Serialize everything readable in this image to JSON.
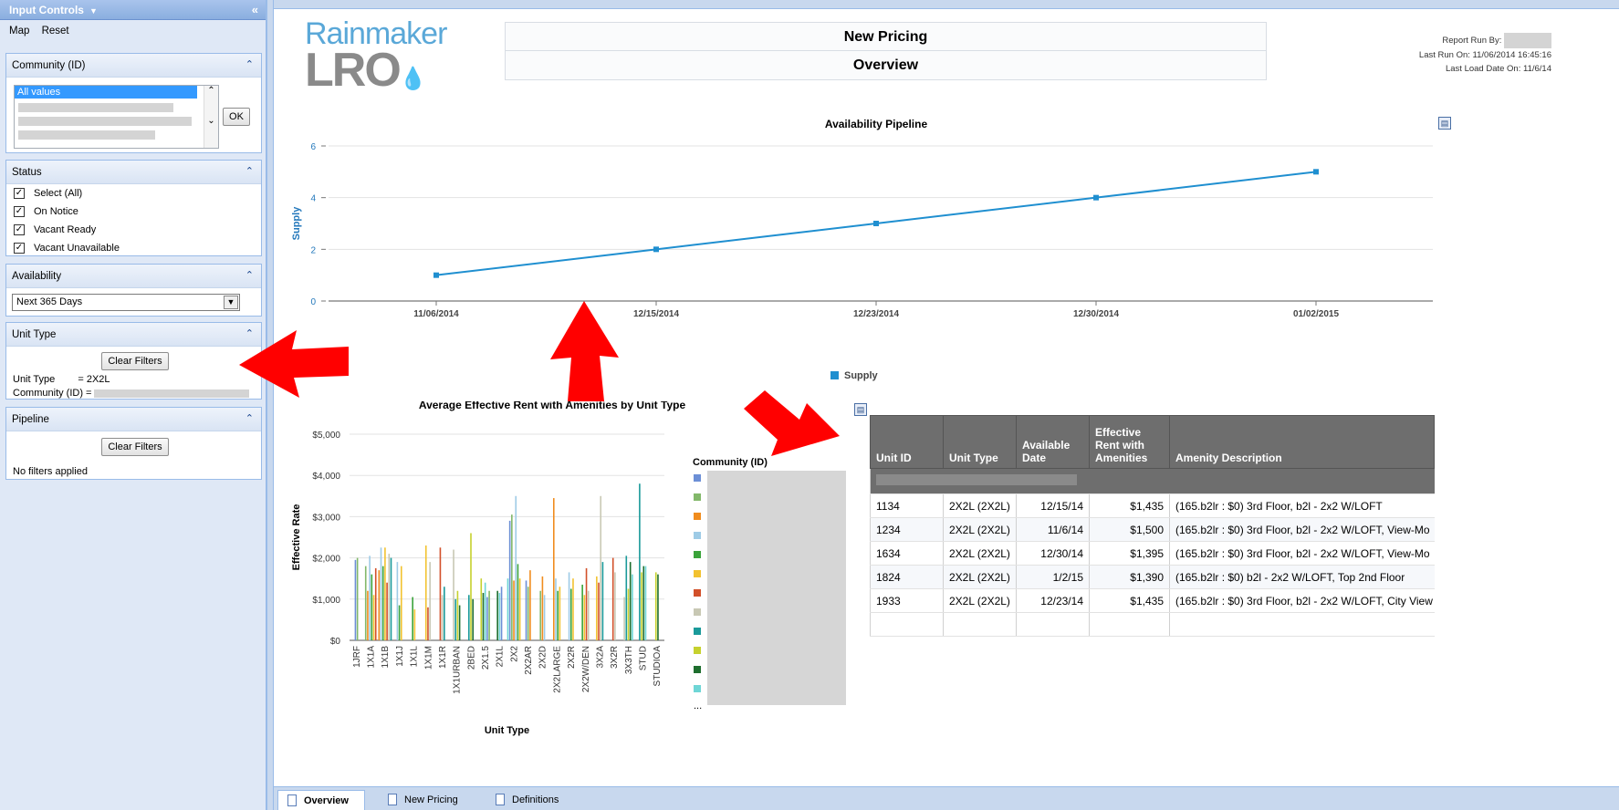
{
  "input_controls": {
    "title": "Input Controls",
    "toolbar": {
      "map": "Map",
      "reset": "Reset"
    },
    "community": {
      "header": "Community (ID)",
      "selected_value": "All values",
      "ok_label": "OK"
    },
    "status": {
      "header": "Status",
      "options": [
        "Select (All)",
        "On Notice",
        "Vacant Ready",
        "Vacant Unavailable"
      ]
    },
    "availability": {
      "header": "Availability",
      "selected": "Next 365 Days"
    },
    "unit_type": {
      "header": "Unit Type",
      "clear_label": "Clear Filters",
      "filter_unit_label": "Unit Type",
      "filter_unit_value": "= 2X2L",
      "filter_community_label": "Community (ID) ="
    },
    "pipeline": {
      "header": "Pipeline",
      "clear_label": "Clear Filters",
      "empty_text": "No filters applied"
    }
  },
  "report": {
    "logo": {
      "brand": "Rainmaker",
      "product": "LRO"
    },
    "title_line1": "New Pricing",
    "title_line2": "Overview",
    "report_run_by_label": "Report Run By:",
    "last_run_on": "Last Run On: 11/06/2014 16:45:16",
    "last_load_date": "Last Load Date On: 11/6/14"
  },
  "tabs": [
    {
      "label": "Overview",
      "active": true
    },
    {
      "label": "New Pricing",
      "active": false
    },
    {
      "label": "Definitions",
      "active": false
    }
  ],
  "table": {
    "headers": [
      "Unit ID",
      "Unit Type",
      "Available Date",
      "Effective Rent with Amenities",
      "Amenity Description"
    ],
    "rows": [
      [
        "1134",
        "2X2L (2X2L)",
        "12/15/14",
        "$1,435",
        "(165.b2lr : $0)   3rd Floor, b2l - 2x2 W/LOFT"
      ],
      [
        "1234",
        "2X2L (2X2L)",
        "11/6/14",
        "$1,500",
        "(165.b2lr : $0)   3rd Floor, b2l - 2x2 W/LOFT, View-Mo"
      ],
      [
        "1634",
        "2X2L (2X2L)",
        "12/30/14",
        "$1,395",
        "(165.b2lr : $0)   3rd Floor, b2l - 2x2 W/LOFT, View-Mo"
      ],
      [
        "1824",
        "2X2L (2X2L)",
        "1/2/15",
        "$1,390",
        "(165.b2lr : $0)   b2l - 2x2 W/LOFT, Top 2nd Floor"
      ],
      [
        "1933",
        "2X2L (2X2L)",
        "12/23/14",
        "$1,435",
        "(165.b2lr : $0)   3rd Floor, b2l - 2x2 W/LOFT, City View"
      ]
    ]
  },
  "chart_data": [
    {
      "type": "line",
      "title": "Availability Pipeline",
      "xlabel": "",
      "ylabel": "Supply",
      "x": [
        "11/06/2014",
        "12/15/2014",
        "12/23/2014",
        "12/30/2014",
        "01/02/2015"
      ],
      "series": [
        {
          "name": "Supply",
          "values": [
            1,
            2,
            3,
            4,
            5
          ],
          "color": "#1f8fd0"
        }
      ],
      "yticks": [
        0,
        2,
        4,
        6
      ],
      "ylim": [
        0,
        6
      ],
      "legend": "bottom"
    },
    {
      "type": "bar",
      "title": "Average Effective Rent with Amenities by Unit Type",
      "xlabel": "Unit Type",
      "ylabel": "Effective Rate",
      "legend_title": "Community (ID)",
      "legend_more": "...",
      "ylim": [
        0,
        5000
      ],
      "yticks": [
        "$0",
        "$1,000",
        "$2,000",
        "$3,000",
        "$4,000",
        "$5,000"
      ],
      "categories": [
        "1JRF",
        "1X1A",
        "1X1B",
        "1X1J",
        "1X1L",
        "1X1M",
        "1X1R",
        "1X1URBAN",
        "2BED",
        "2X1.5",
        "2X1L",
        "2X2",
        "2X2AR",
        "2X2D",
        "2X2LARGE",
        "2X2R",
        "2X2W/DEN",
        "3X2A",
        "3X2R",
        "3X3TH",
        "STUD",
        "STUDIOA"
      ],
      "palette": [
        "#6c8fd6",
        "#82b86a",
        "#f08c1e",
        "#9ecbe6",
        "#3aa33a",
        "#f2c230",
        "#d2502a",
        "#c8c8b4",
        "#1a9a9a",
        "#c6d12e",
        "#1e6e2e",
        "#6fd6d6"
      ],
      "groups": [
        [
          1950,
          2000
        ],
        [
          1800,
          1200,
          2050,
          1600,
          1100,
          1750
        ],
        [
          1700,
          2250,
          1800,
          2250,
          1400,
          2100,
          2000
        ],
        [
          1900,
          850,
          1800
        ],
        [
          1050,
          750
        ],
        [
          2300,
          800,
          1900
        ],
        [
          2250,
          1100,
          1300
        ],
        [
          2200,
          1000,
          1200,
          850
        ],
        [
          1100,
          2600,
          1000
        ],
        [
          1500,
          1150,
          1400,
          1050,
          1200
        ],
        [
          1200,
          1150,
          1300
        ],
        [
          1500,
          2900,
          3050,
          1450,
          3500,
          1850,
          1500
        ],
        [
          1450,
          1300,
          1700
        ],
        [
          1200,
          1550,
          1100
        ],
        [
          3450,
          1500,
          1200,
          1300
        ],
        [
          1650,
          1250,
          1500
        ],
        [
          1350,
          1100,
          1750,
          1200
        ],
        [
          1550,
          1400,
          3500,
          1900
        ],
        [
          2000,
          1650
        ],
        [
          1050,
          2050,
          1250,
          1900,
          1600
        ],
        [
          3800,
          1650,
          1800,
          1800
        ],
        [
          1650,
          1600
        ]
      ]
    }
  ]
}
